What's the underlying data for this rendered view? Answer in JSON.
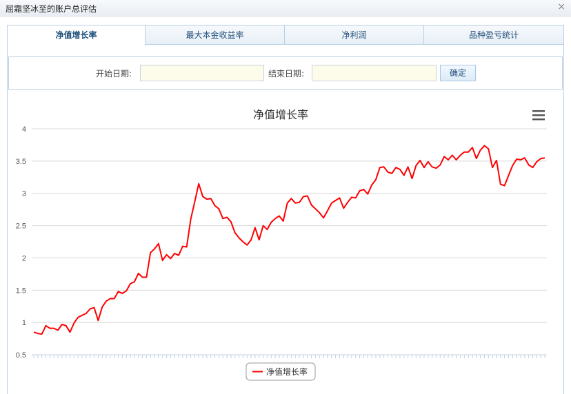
{
  "window": {
    "title": "屈霜坚冰至的账户总评估",
    "close_glyph": "×"
  },
  "tabs": [
    {
      "label": "净值增长率",
      "active": true
    },
    {
      "label": "最大本金收益率",
      "active": false
    },
    {
      "label": "净利润",
      "active": false
    },
    {
      "label": "品种盈亏统计",
      "active": false
    }
  ],
  "filter": {
    "start_label": "开始日期:",
    "start_value": "",
    "end_label": "结束日期:",
    "end_value": "",
    "confirm_label": "确定"
  },
  "chart_data": {
    "type": "line",
    "title": "净值增长率",
    "xlabel": "",
    "ylabel": "",
    "ylim": [
      0.5,
      4
    ],
    "yticks": [
      "0.5",
      "1",
      "1.5",
      "2",
      "2.5",
      "3",
      "3.5",
      "4"
    ],
    "grid": true,
    "legend_position": "bottom-center",
    "menu_icon": "hamburger-menu-icon",
    "series": [
      {
        "name": "净值增长率",
        "color": "#ff0000",
        "values": [
          0.85,
          0.83,
          0.82,
          0.95,
          0.91,
          0.91,
          0.88,
          0.97,
          0.95,
          0.85,
          0.99,
          1.08,
          1.11,
          1.14,
          1.21,
          1.23,
          1.03,
          1.24,
          1.33,
          1.37,
          1.37,
          1.48,
          1.45,
          1.49,
          1.6,
          1.63,
          1.76,
          1.7,
          1.7,
          2.08,
          2.14,
          2.22,
          1.96,
          2.05,
          1.99,
          2.07,
          2.04,
          2.18,
          2.17,
          2.6,
          2.87,
          3.15,
          2.95,
          2.91,
          2.92,
          2.81,
          2.76,
          2.61,
          2.63,
          2.56,
          2.39,
          2.31,
          2.25,
          2.2,
          2.28,
          2.47,
          2.28,
          2.5,
          2.44,
          2.55,
          2.61,
          2.65,
          2.57,
          2.85,
          2.92,
          2.85,
          2.86,
          2.95,
          2.96,
          2.82,
          2.76,
          2.7,
          2.62,
          2.73,
          2.85,
          2.89,
          2.93,
          2.77,
          2.86,
          2.94,
          2.93,
          3.04,
          3.06,
          2.99,
          3.13,
          3.21,
          3.4,
          3.41,
          3.33,
          3.31,
          3.4,
          3.37,
          3.28,
          3.41,
          3.23,
          3.43,
          3.51,
          3.4,
          3.49,
          3.41,
          3.39,
          3.44,
          3.57,
          3.52,
          3.59,
          3.52,
          3.59,
          3.64,
          3.64,
          3.71,
          3.54,
          3.67,
          3.74,
          3.69,
          3.4,
          3.51,
          3.14,
          3.12,
          3.28,
          3.43,
          3.53,
          3.52,
          3.55,
          3.44,
          3.4,
          3.49,
          3.54,
          3.55
        ]
      }
    ]
  }
}
